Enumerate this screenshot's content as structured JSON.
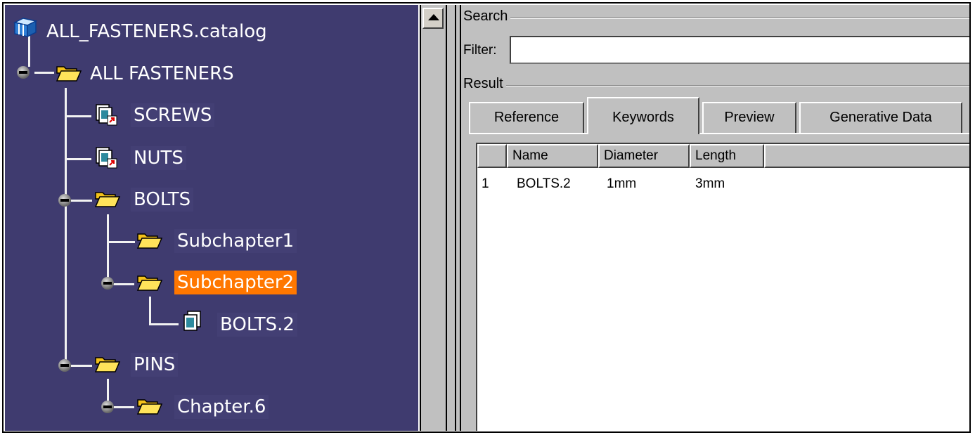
{
  "tree": {
    "root": "ALL_FASTENERS.catalog",
    "nodes": {
      "all_fasteners": "ALL FASTENERS",
      "screws": "SCREWS",
      "nuts": "NUTS",
      "bolts": "BOLTS",
      "subchapter1": "Subchapter1",
      "subchapter2": "Subchapter2",
      "bolts2": "BOLTS.2",
      "pins": "PINS",
      "chapter6": "Chapter.6"
    },
    "selected": "Subchapter2"
  },
  "search": {
    "group_label": "Search",
    "filter_label": "Filter:",
    "filter_value": ""
  },
  "result": {
    "group_label": "Result",
    "tabs": [
      "Reference",
      "Keywords",
      "Preview",
      "Generative Data"
    ],
    "active_tab": "Keywords",
    "columns": [
      "Name",
      "Diameter",
      "Length"
    ],
    "rows": [
      {
        "index": "1",
        "name": "BOLTS.2",
        "diameter": "1mm",
        "length": "3mm"
      }
    ]
  },
  "colors": {
    "tree_bg": "#3f3b6f",
    "selection": "#ff7700",
    "panel_bg": "#c0c0c0"
  }
}
